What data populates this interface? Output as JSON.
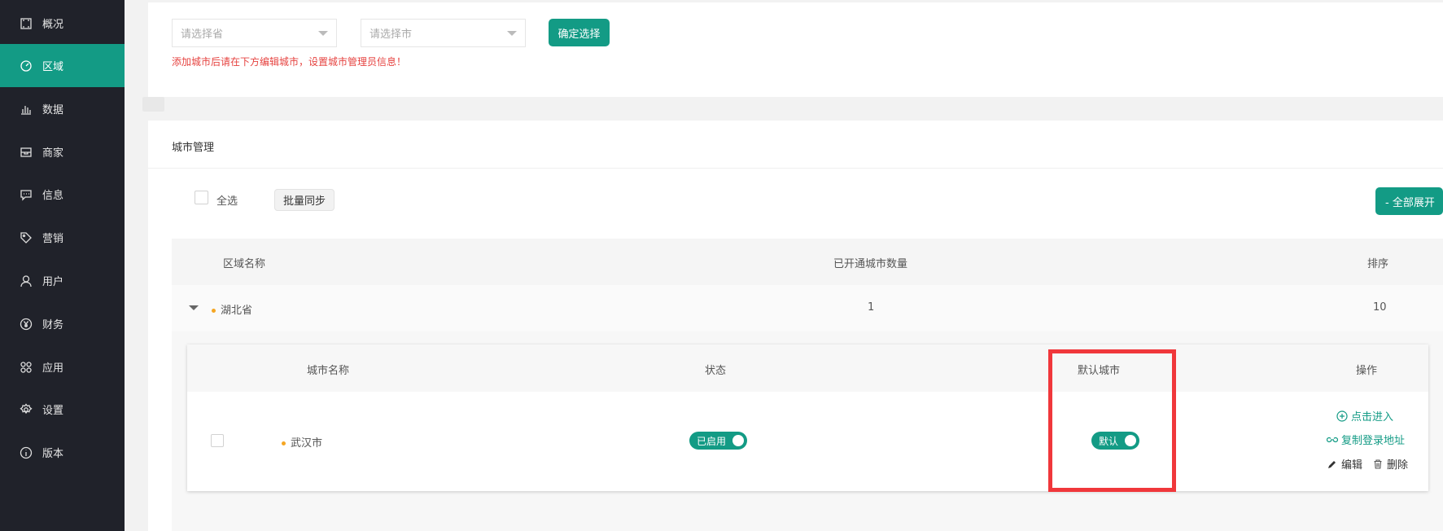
{
  "sidebar": {
    "items": [
      {
        "label": "概况",
        "icon": "overview-icon",
        "active": false
      },
      {
        "label": "区域",
        "icon": "region-icon",
        "active": true
      },
      {
        "label": "数据",
        "icon": "bar-chart-icon",
        "active": false
      },
      {
        "label": "商家",
        "icon": "store-icon",
        "active": false
      },
      {
        "label": "信息",
        "icon": "message-icon",
        "active": false
      },
      {
        "label": "营销",
        "icon": "tag-icon",
        "active": false
      },
      {
        "label": "用户",
        "icon": "user-icon",
        "active": false
      },
      {
        "label": "财务",
        "icon": "yen-icon",
        "active": false
      },
      {
        "label": "应用",
        "icon": "apps-icon",
        "active": false
      },
      {
        "label": "设置",
        "icon": "gear-icon",
        "active": false
      },
      {
        "label": "版本",
        "icon": "info-icon",
        "active": false
      }
    ]
  },
  "city_select": {
    "province_placeholder": "请选择省",
    "city_placeholder": "请选择市",
    "confirm_label": "确定选择",
    "hint": "添加城市后请在下方编辑城市，设置城市管理员信息！"
  },
  "city_management": {
    "title": "城市管理",
    "select_all_label": "全选",
    "batch_sync_label": "批量同步",
    "expand_all_label": "- 全部展开",
    "region_table": {
      "headers": [
        "区域名称",
        "已开通城市数量",
        "排序"
      ],
      "rows": [
        {
          "name": "湖北省",
          "city_count": "1",
          "sort": "10"
        }
      ]
    },
    "city_table": {
      "headers": [
        "城市名称",
        "状态",
        "默认城市",
        "操作"
      ],
      "rows": [
        {
          "name": "武汉市",
          "status_label": "已启用",
          "default_label": "默认",
          "actions": {
            "enter": "点击进入",
            "copy_login": "复制登录地址",
            "edit": "编辑",
            "delete": "删除"
          }
        }
      ]
    }
  },
  "colors": {
    "accent": "#139b85",
    "sidebar_bg": "#20222a",
    "hint": "#e64340",
    "highlight": "#f0373b",
    "dot": "#f5a623"
  }
}
